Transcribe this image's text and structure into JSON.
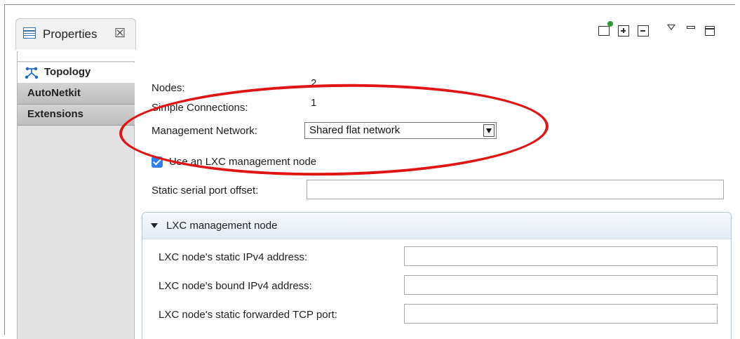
{
  "view": {
    "title": "Properties",
    "close_glyph": "☒"
  },
  "toolbar": {
    "icons": [
      "pin-to-view-icon",
      "expand-all-icon",
      "collapse-all-icon",
      "view-menu-icon",
      "minimize-icon",
      "maximize-icon"
    ]
  },
  "sidebar": {
    "tabs": [
      {
        "label": "Topology",
        "icon": "topology-icon",
        "active": true
      },
      {
        "label": "AutoNetkit",
        "active": false
      },
      {
        "label": "Extensions",
        "active": false
      }
    ]
  },
  "main": {
    "nodes_label": "Nodes:",
    "nodes_value": "2",
    "connections_label": "Simple Connections:",
    "connections_value": "1",
    "mgmt_label": "Management Network:",
    "mgmt_value": "Shared flat network",
    "lxc_checkbox_label": "Use an LXC management node",
    "lxc_checkbox_checked": true,
    "serial_label": "Static serial port offset:",
    "serial_value": ""
  },
  "lxc_section": {
    "title": "LXC management node",
    "static_ipv4_label": "LXC node's static IPv4 address:",
    "bound_ipv4_label": "LXC node's bound IPv4 address:",
    "tcp_port_label": "LXC node's static forwarded TCP port:"
  },
  "colors": {
    "highlight_ellipse": "#e11414",
    "checkbox_accent": "#2f7ff2"
  }
}
